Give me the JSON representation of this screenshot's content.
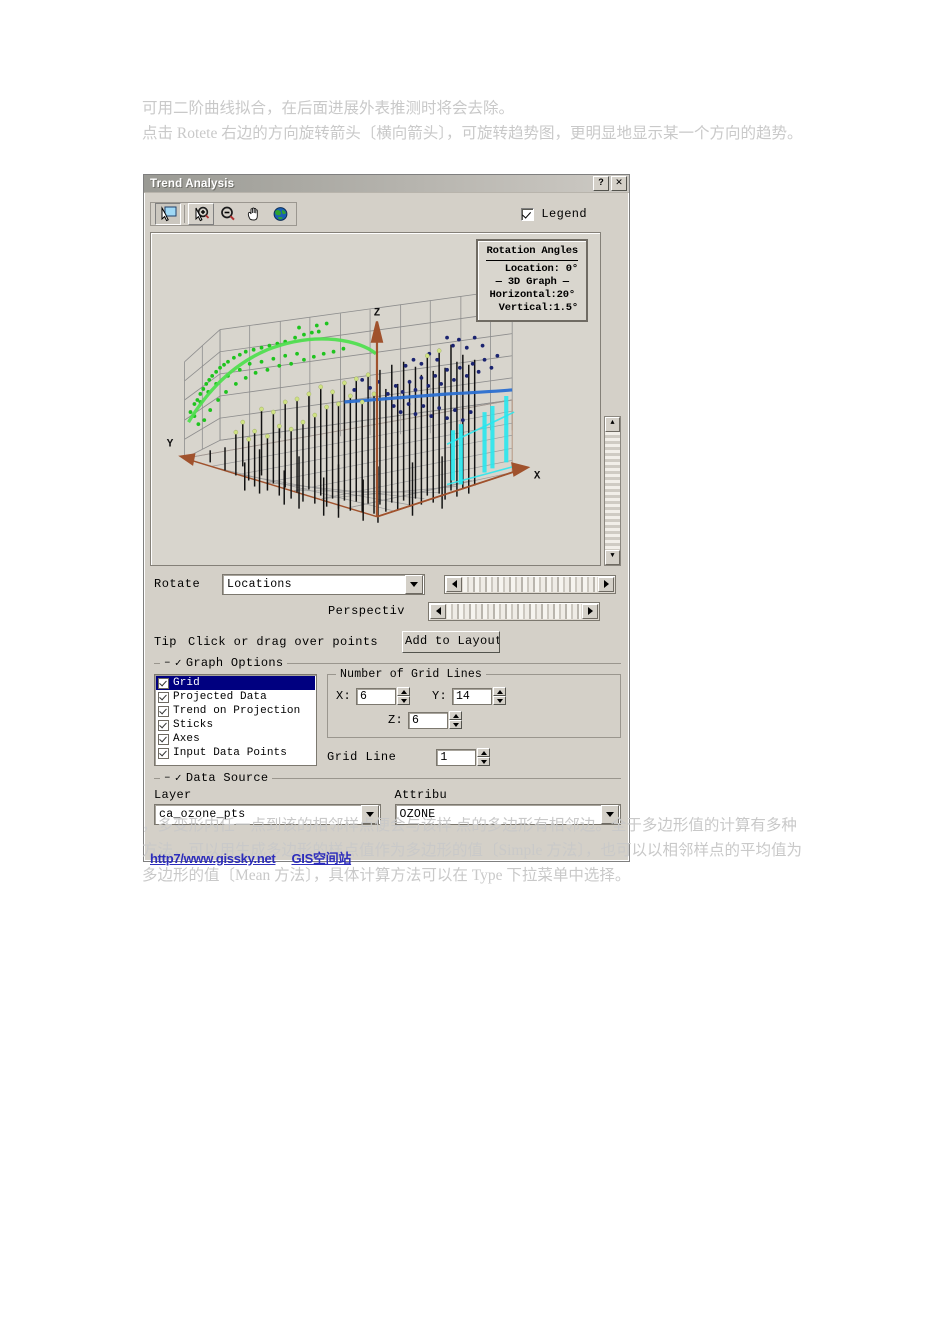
{
  "document": {
    "paragraph_top": "可用二阶曲线拟合，在后面进展外表推测时将会去除。\n点击 Rotete 右边的方向旋转箭头〔横向箭头〕，可旋转趋势图，更明显地显示某一个方向的趋势。",
    "paragraph_bottom": "，多变形内任一点到该的相邻样点便会与该样 点的多边形有相邻边。全于多边形值的计算有多种方法，可以用生成多边形的样点值作为多边形的值〔Simple 方法〕，也可以以相邻样点的平均值为多边形的值〔Mean 方法〕，具体计算方法可以在 Type 下拉菜单中选择。",
    "watermark_url": "http7/www.gissky.net",
    "watermark_site": "GIS空间站"
  },
  "window": {
    "title": "Trend Analysis",
    "help_button": "?",
    "close_button": "✕"
  },
  "toolbar": {
    "tools": [
      {
        "name": "select-tool",
        "glyph": "select",
        "state": "sunken"
      },
      {
        "name": "zoom-in-tool",
        "glyph": "zoom-in",
        "state": "raised"
      },
      {
        "name": "zoom-out-tool",
        "glyph": "zoom-out",
        "state": "flat"
      },
      {
        "name": "pan-tool",
        "glyph": "hand",
        "state": "flat"
      },
      {
        "name": "full-extent-tool",
        "glyph": "globe",
        "state": "flat"
      }
    ],
    "legend_label": "Legend",
    "legend_checked": true
  },
  "rotation_legend": {
    "title": "Rotation Angles",
    "location": "Location: 0°",
    "graph_divider": "— 3D Graph —",
    "horizontal": "Horizontal:20°",
    "vertical": "Vertical:1.5°"
  },
  "graph": {
    "axis_x": "X",
    "axis_y": "Y",
    "axis_z": "Z",
    "colors": {
      "background": "#d8d5cd",
      "grid": "#8d8d8d",
      "base_grid": "#b08b74",
      "axis_arrow": "#a0522d",
      "sticks": "#000000",
      "projection_green": "#22cc22",
      "projection_blue": "#202a80",
      "trend_green": "#44e044",
      "trend_blue": "#2b6fd0",
      "selected_cyan": "#25e8f0",
      "points_light": "#d6e89a"
    }
  },
  "controls": {
    "rotate_label": "Rotate",
    "rotate_value": "Locations",
    "rotate_options": [
      "Locations"
    ],
    "perspective_label": "Perspectiv",
    "tip_label": "Tip",
    "tip_text": "Click or drag over points",
    "add_to_layout": "Add to Layout"
  },
  "graph_options": {
    "title": "Graph Options",
    "items": [
      {
        "label": "Grid",
        "checked": true,
        "selected": true
      },
      {
        "label": "Projected Data",
        "checked": true,
        "selected": false
      },
      {
        "label": "Trend on Projection",
        "checked": true,
        "selected": false
      },
      {
        "label": "Sticks",
        "checked": true,
        "selected": false
      },
      {
        "label": "Axes",
        "checked": true,
        "selected": false
      },
      {
        "label": "Input Data Points",
        "checked": true,
        "selected": false
      }
    ],
    "grid_lines": {
      "title": "Number of Grid Lines",
      "x_label": "X:",
      "x_value": "6",
      "y_label": "Y:",
      "y_value": "14",
      "z_label": "Z:",
      "z_value": "6"
    },
    "grid_line_label": "Grid Line",
    "grid_line_value": "1"
  },
  "data_source": {
    "title": "Data Source",
    "layer_label": "Layer",
    "layer_value": "ca_ozone_pts",
    "attribute_label": "Attribu",
    "attribute_value": "OZONE"
  }
}
